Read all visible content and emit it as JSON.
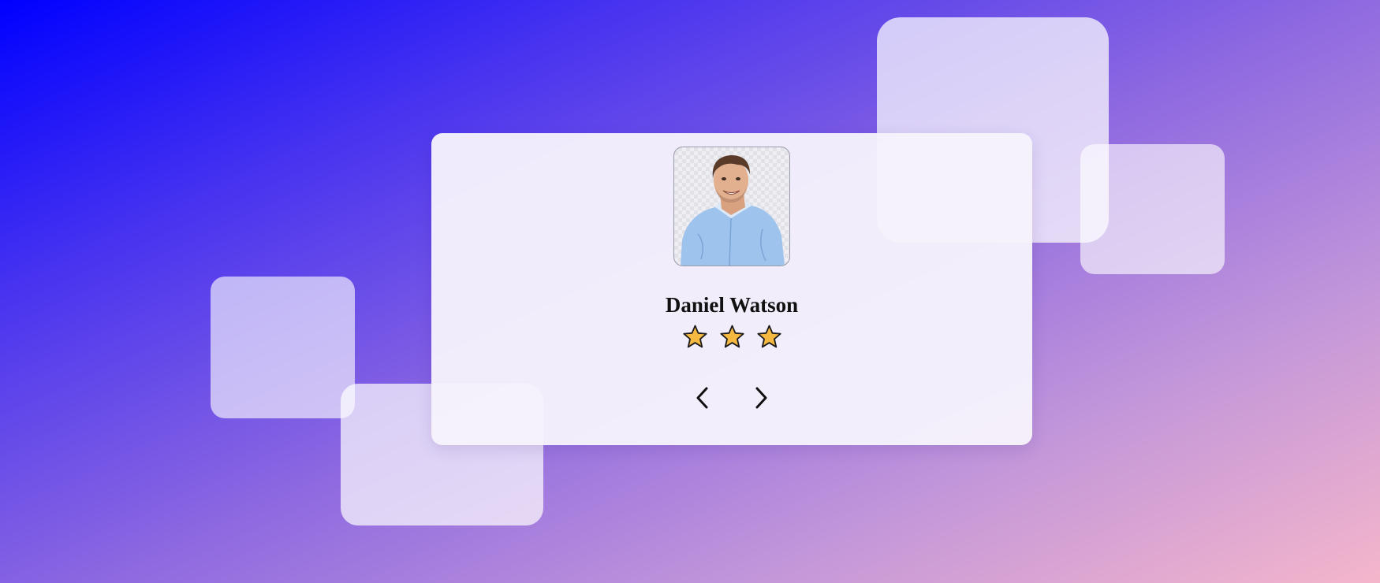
{
  "testimonial": {
    "name": "Daniel Watson",
    "rating": 3,
    "rating_max": 3,
    "star_color": "#f5b942"
  },
  "navigation": {
    "prev_icon": "chevron-left-icon",
    "next_icon": "chevron-right-icon"
  },
  "colors": {
    "gradient_start": "#0000ff",
    "gradient_end": "#f5b6cb",
    "card_background": "#f6f3fc"
  }
}
